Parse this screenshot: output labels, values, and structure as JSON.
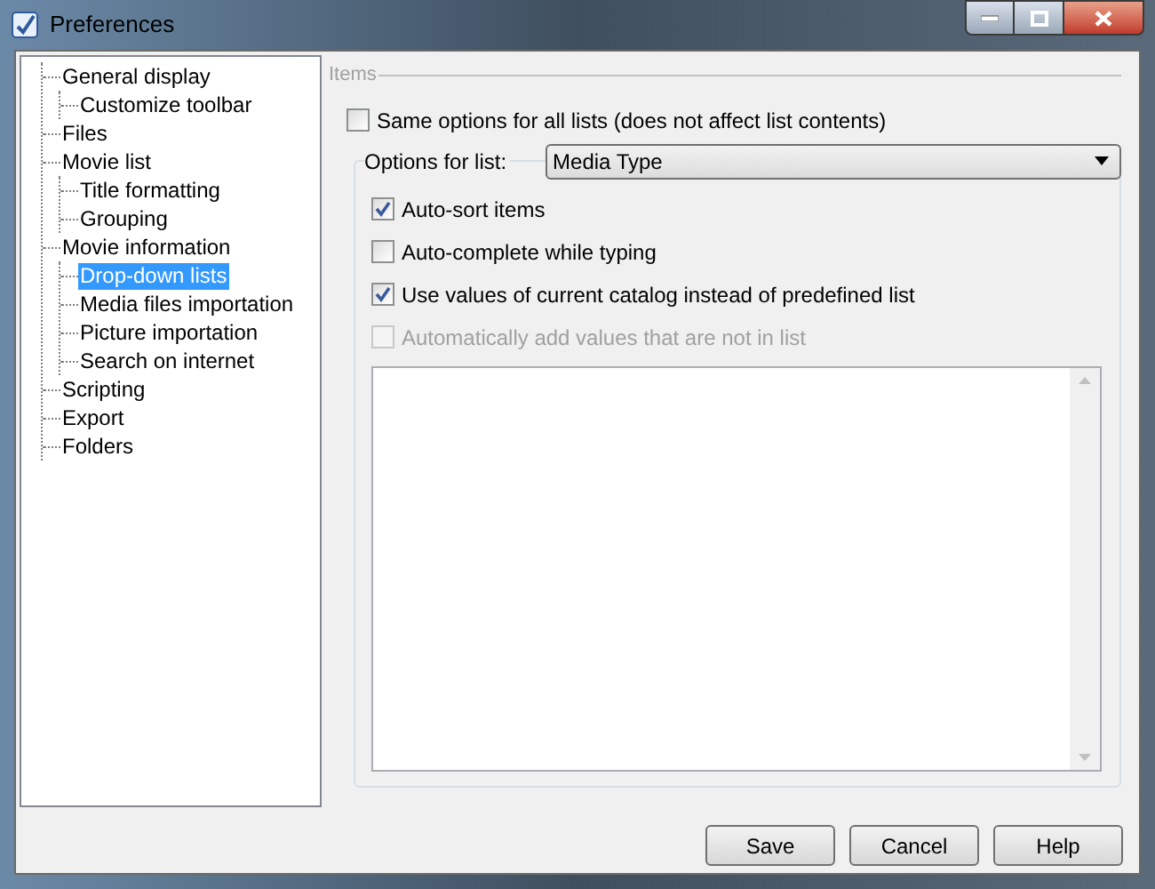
{
  "window": {
    "title": "Preferences"
  },
  "tree": [
    {
      "label": "General display",
      "selected": false,
      "children": [
        {
          "label": "Customize toolbar",
          "selected": false
        }
      ]
    },
    {
      "label": "Files",
      "selected": false
    },
    {
      "label": "Movie list",
      "selected": false,
      "children": [
        {
          "label": "Title formatting",
          "selected": false
        },
        {
          "label": "Grouping",
          "selected": false
        }
      ]
    },
    {
      "label": "Movie information",
      "selected": false,
      "children": [
        {
          "label": "Drop-down lists",
          "selected": true
        },
        {
          "label": "Media files importation",
          "selected": false
        },
        {
          "label": "Picture importation",
          "selected": false
        },
        {
          "label": "Search on internet",
          "selected": false
        }
      ]
    },
    {
      "label": "Scripting",
      "selected": false
    },
    {
      "label": "Export",
      "selected": false
    },
    {
      "label": "Folders",
      "selected": false
    }
  ],
  "items_group": {
    "label": "Items"
  },
  "same_options": {
    "label": "Same options for all lists (does not affect list contents)",
    "checked": false
  },
  "options_for_list": {
    "label": "Options for list:",
    "value": "Media Type"
  },
  "options": [
    {
      "label": "Auto-sort items",
      "checked": true,
      "disabled": false
    },
    {
      "label": "Auto-complete while typing",
      "checked": false,
      "disabled": false
    },
    {
      "label": "Use values of current catalog instead of predefined list",
      "checked": true,
      "disabled": false
    },
    {
      "label": "Automatically add values that are not in list",
      "checked": false,
      "disabled": true
    }
  ],
  "buttons": [
    "Save",
    "Cancel",
    "Help"
  ]
}
